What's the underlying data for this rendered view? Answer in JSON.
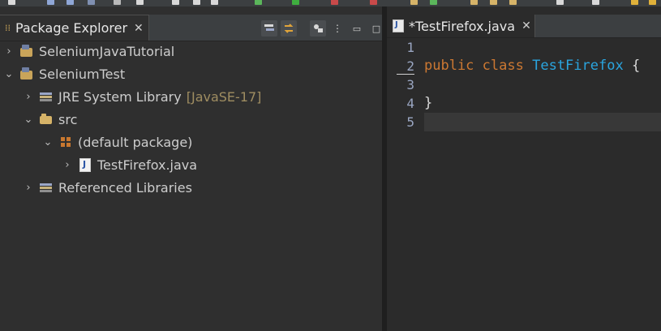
{
  "left_view": {
    "tab_title": "Package Explorer",
    "close_glyph": "✕",
    "minimize_glyph": "▭",
    "maximize_glyph": "□"
  },
  "tree": [
    {
      "label": "SeleniumJavaTutorial",
      "arrow": "›",
      "icon": "project-icon",
      "depth": 0
    },
    {
      "label": "SeleniumTest",
      "arrow": "⌄",
      "icon": "project-icon",
      "depth": 0
    },
    {
      "label": "JRE System Library",
      "decor": "[JavaSE-17]",
      "arrow": "›",
      "icon": "library-icon",
      "depth": 1
    },
    {
      "label": "src",
      "arrow": "⌄",
      "icon": "source-folder-icon",
      "depth": 1
    },
    {
      "label": "(default package)",
      "arrow": "⌄",
      "icon": "package-icon",
      "depth": 2
    },
    {
      "label": "TestFirefox.java",
      "arrow": "›",
      "icon": "java-file-icon",
      "depth": 3
    },
    {
      "label": "Referenced Libraries",
      "arrow": "›",
      "icon": "library-icon",
      "depth": 1
    }
  ],
  "editor": {
    "tab_title": "*TestFirefox.java",
    "close_glyph": "✕",
    "line_numbers": [
      "1",
      "2",
      "3",
      "4",
      "5"
    ],
    "code": {
      "line2_kw1": "public",
      "line2_kw2": "class",
      "line2_class": "TestFirefox",
      "line2_brace": "{",
      "line4": "}"
    }
  },
  "colors": {
    "keyword": "#cc7832",
    "class_name": "#2aa5df",
    "background": "#2f2f2f"
  }
}
